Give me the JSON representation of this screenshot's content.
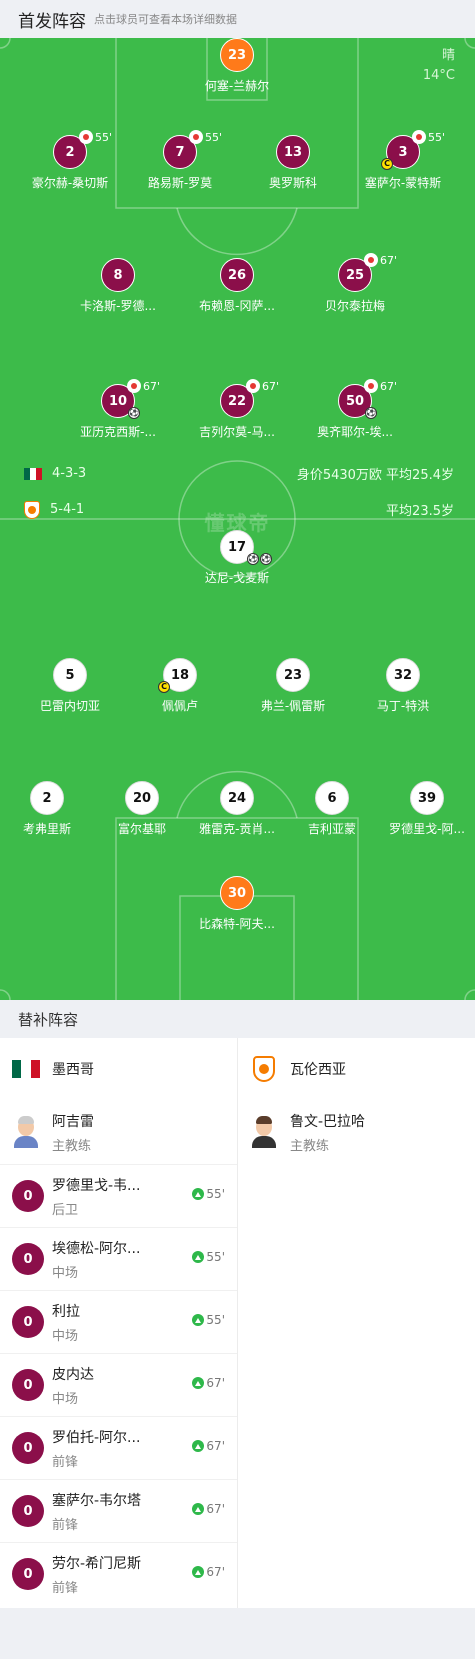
{
  "header": {
    "title": "首发阵容",
    "hint": "点击球员可查看本场详细数据"
  },
  "weather": {
    "condition": "晴",
    "temperature": "14°C"
  },
  "watermark": "懂球帝",
  "home": {
    "formation": "4-3-3",
    "stats": "身价5430万欧  平均25.4岁",
    "players": [
      {
        "num": "23",
        "name": "何塞-兰赫尔",
        "gk": true
      },
      {
        "num": "2",
        "name": "豪尔赫-桑切斯",
        "sub": "55'"
      },
      {
        "num": "7",
        "name": "路易斯-罗莫",
        "sub": "55'"
      },
      {
        "num": "13",
        "name": "奥罗斯科"
      },
      {
        "num": "3",
        "name": "塞萨尔-蒙特斯",
        "sub": "55'",
        "card": "C"
      },
      {
        "num": "8",
        "name": "卡洛斯-罗德..."
      },
      {
        "num": "26",
        "name": "布赖恩-冈萨..."
      },
      {
        "num": "25",
        "name": "贝尔泰拉梅",
        "sub": "67'"
      },
      {
        "num": "10",
        "name": "亚历克西斯-...",
        "sub": "67'",
        "goals": 1
      },
      {
        "num": "22",
        "name": "吉列尔莫-马...",
        "sub": "67'"
      },
      {
        "num": "50",
        "name": "奥齐耶尔-埃...",
        "sub": "67'",
        "goals": 1
      }
    ]
  },
  "away": {
    "formation": "5-4-1",
    "stats": "平均23.5岁",
    "players": [
      {
        "num": "17",
        "name": "达尼-戈麦斯",
        "goals": 2
      },
      {
        "num": "5",
        "name": "巴雷内切亚"
      },
      {
        "num": "18",
        "name": "佩佩卢",
        "card": "C"
      },
      {
        "num": "23",
        "name": "弗兰-佩雷斯"
      },
      {
        "num": "32",
        "name": "马丁-特洪"
      },
      {
        "num": "2",
        "name": "考弗里斯"
      },
      {
        "num": "20",
        "name": "富尔基耶"
      },
      {
        "num": "24",
        "name": "雅雷克-贡肖..."
      },
      {
        "num": "6",
        "name": "吉利亚蒙"
      },
      {
        "num": "39",
        "name": "罗德里戈-阿..."
      },
      {
        "num": "30",
        "name": "比森特-阿夫...",
        "gk": true
      }
    ]
  },
  "substitutes": {
    "title": "替补阵容",
    "left": {
      "team": "墨西哥",
      "coach": {
        "name": "阿吉雷",
        "role": "主教练"
      },
      "players": [
        {
          "num": "0",
          "name": "罗德里戈-韦...",
          "role": "后卫",
          "in": "55'"
        },
        {
          "num": "0",
          "name": "埃德松-阿尔...",
          "role": "中场",
          "in": "55'"
        },
        {
          "num": "0",
          "name": "利拉",
          "role": "中场",
          "in": "55'"
        },
        {
          "num": "0",
          "name": "皮内达",
          "role": "中场",
          "in": "67'"
        },
        {
          "num": "0",
          "name": "罗伯托-阿尔...",
          "role": "前锋",
          "in": "67'"
        },
        {
          "num": "0",
          "name": "塞萨尔-韦尔塔",
          "role": "前锋",
          "in": "67'"
        },
        {
          "num": "0",
          "name": "劳尔-希门尼斯",
          "role": "前锋",
          "in": "67'"
        }
      ]
    },
    "right": {
      "team": "瓦伦西亚",
      "coach": {
        "name": "鲁文-巴拉哈",
        "role": "主教练"
      }
    }
  },
  "colors": {
    "pitch": "#3dbb4a",
    "home": "#8b0f4a",
    "keeper": "#ff7a1a",
    "sub_in": "#2eb84a",
    "sub_out": "#e53935"
  }
}
